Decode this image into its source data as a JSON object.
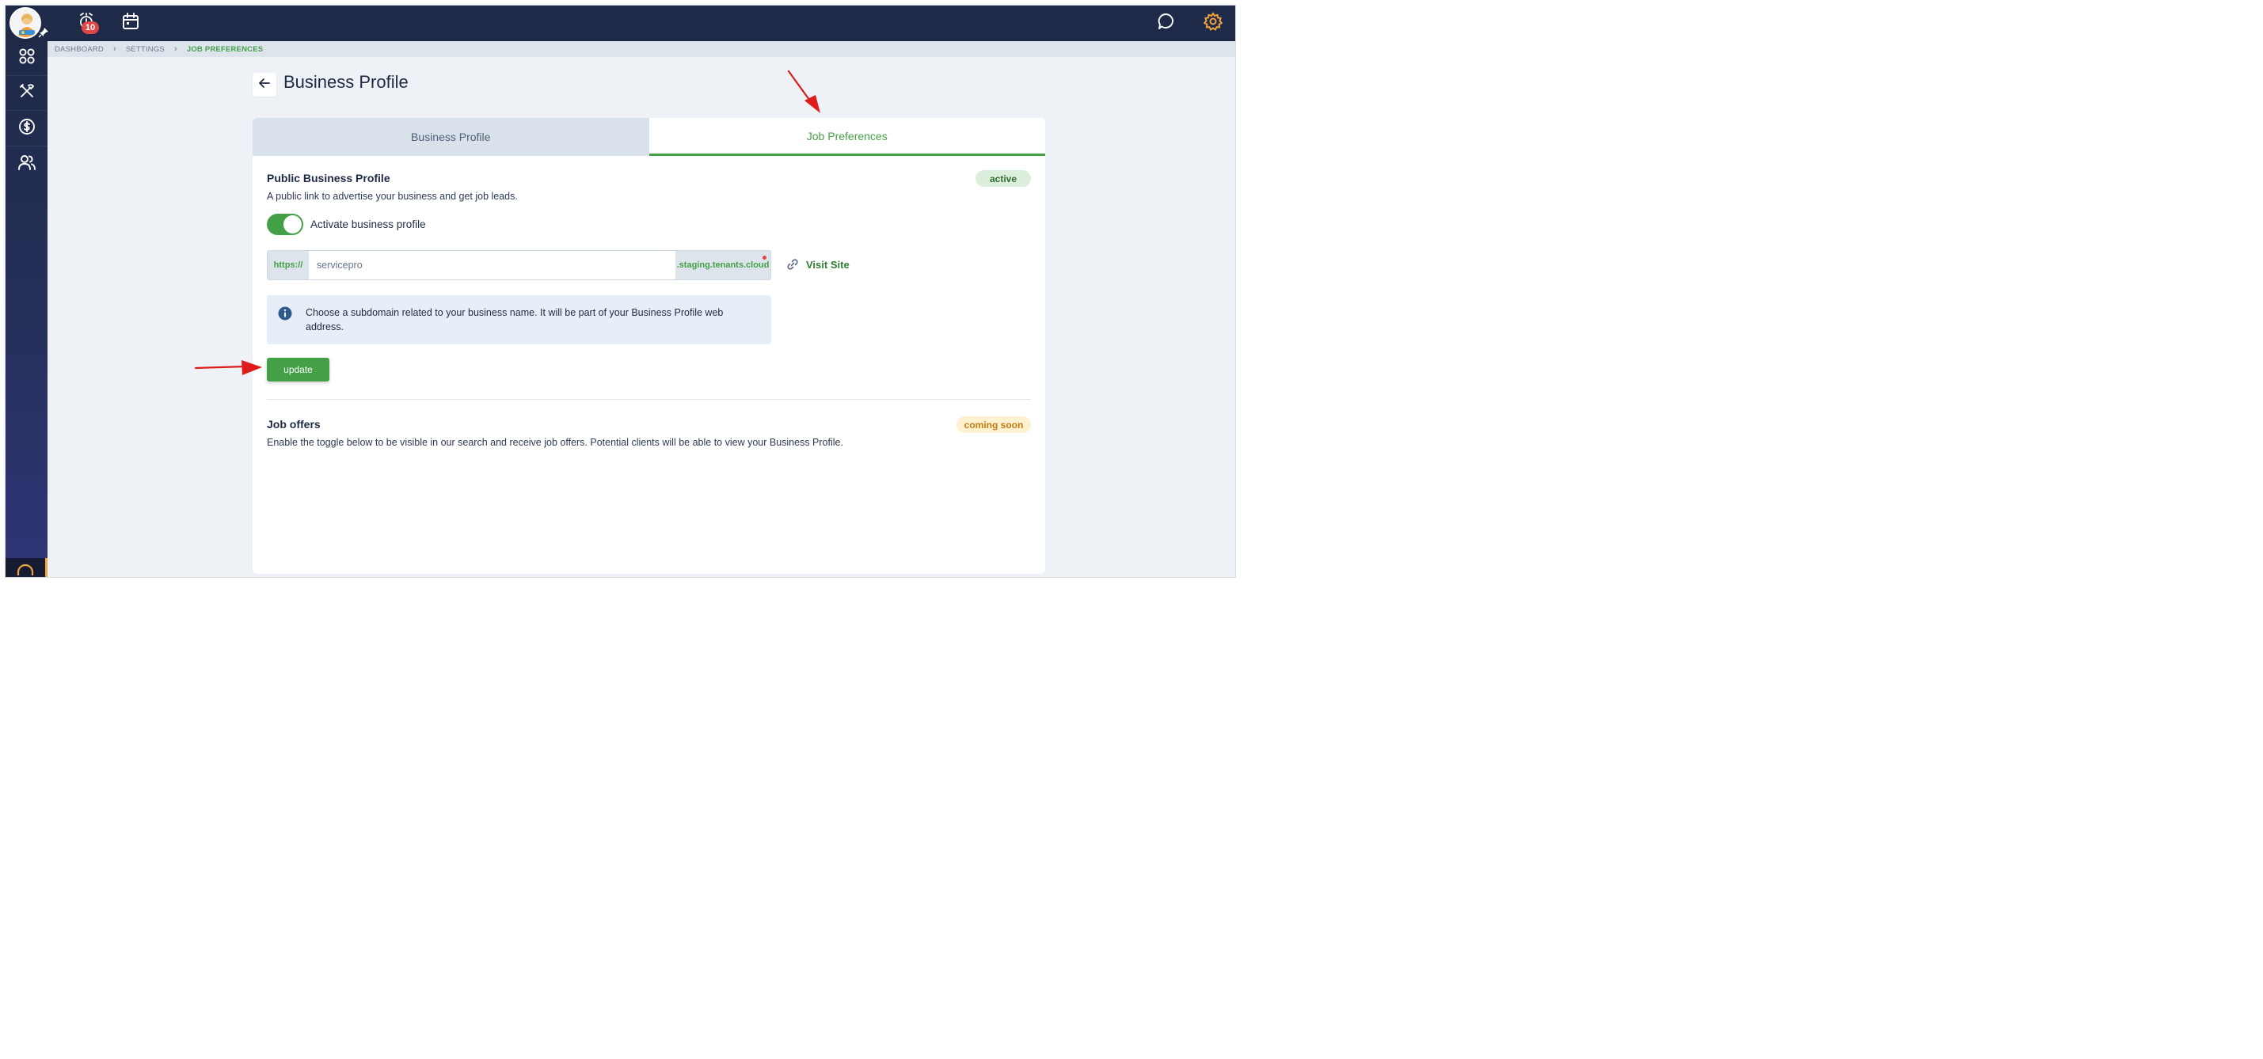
{
  "topbar": {
    "notification_count": "10"
  },
  "breadcrumb": {
    "items": [
      "DASHBOARD",
      "SETTINGS"
    ],
    "current": "JOB PREFERENCES"
  },
  "page": {
    "title": "Business Profile"
  },
  "tabs": [
    {
      "label": "Business Profile",
      "active": false
    },
    {
      "label": "Job Preferences",
      "active": true
    }
  ],
  "public_profile": {
    "title": "Public Business Profile",
    "status": "active",
    "description": "A public link to advertise your business and get job leads.",
    "toggle_label": "Activate business profile",
    "toggle_on": true,
    "url_prefix": "https://",
    "subdomain_value": "servicepro",
    "url_suffix": ".staging.tenants.cloud",
    "visit_label": "Visit Site",
    "info_text": "Choose a subdomain related to your business name. It will be part of your Business Profile web address.",
    "update_label": "update"
  },
  "job_offers": {
    "title": "Job offers",
    "status": "coming soon",
    "description": "Enable the toggle below to be visible in our search and receive job offers. Potential clients will be able to view your Business Profile."
  },
  "colors": {
    "accent_green": "#43a047",
    "nav_dark": "#1f2a48",
    "badge_red": "#e04646",
    "settings_orange": "#f2a23a"
  },
  "icons": {
    "topbar": [
      "avatar",
      "pin-icon",
      "alarm-icon",
      "calendar-icon",
      "chat-icon",
      "gear-icon"
    ],
    "sidebar": [
      "grid-icon",
      "tools-icon",
      "dollar-icon",
      "users-icon",
      "headset-icon"
    ]
  }
}
